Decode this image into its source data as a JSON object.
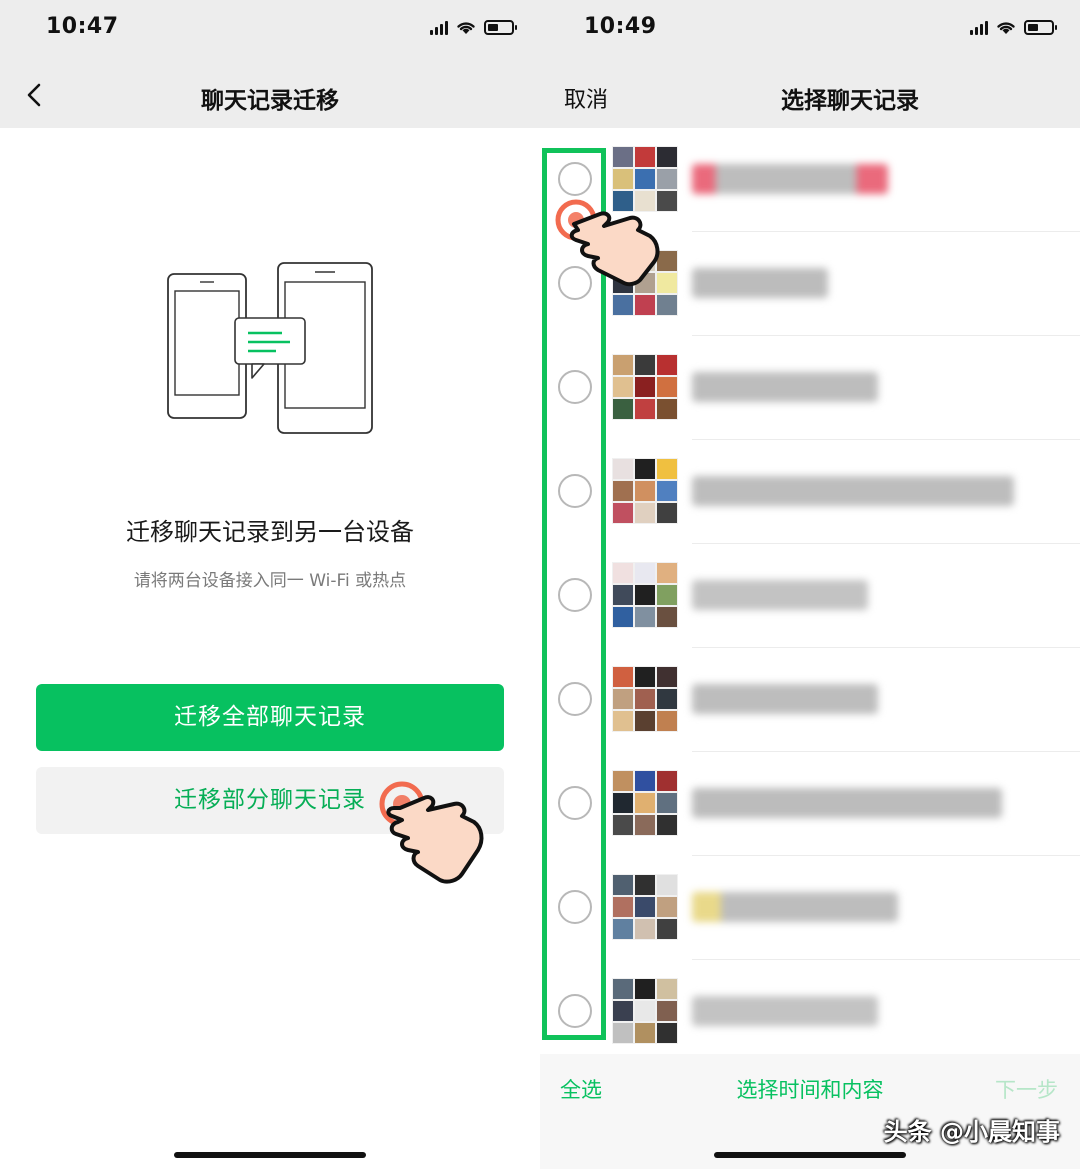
{
  "left": {
    "status_time": "10:47",
    "nav_title": "聊天记录迁移",
    "headline": "迁移聊天记录到另一台设备",
    "subline": "请将两台设备接入同一 Wi-Fi 或热点",
    "primary_button": "迁移全部聊天记录",
    "secondary_button": "迁移部分聊天记录"
  },
  "right": {
    "status_time": "10:49",
    "cancel": "取消",
    "nav_title": "选择聊天记录",
    "select_all": "全选",
    "select_time": "选择时间和内容",
    "next": "下一步",
    "watermark": "头条 @小晨知事"
  },
  "colors": {
    "accent": "#07c160",
    "highlight_box": "#10c25a",
    "tap_marker": "#f26b4f"
  }
}
